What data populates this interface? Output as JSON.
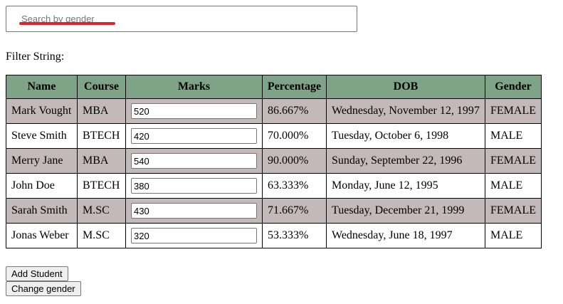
{
  "search": {
    "placeholder": "Search by gender",
    "value": ""
  },
  "filter": {
    "label": "Filter String:"
  },
  "table": {
    "headers": [
      "Name",
      "Course",
      "Marks",
      "Percentage",
      "DOB",
      "Gender"
    ],
    "rows": [
      {
        "name": "Mark Vought",
        "course": "MBA",
        "marks": "520",
        "percentage": "86.667%",
        "dob": "Wednesday, November 12, 1997",
        "gender": "FEMALE"
      },
      {
        "name": "Steve Smith",
        "course": "BTECH",
        "marks": "420",
        "percentage": "70.000%",
        "dob": "Tuesday, October 6, 1998",
        "gender": "MALE"
      },
      {
        "name": "Merry Jane",
        "course": "MBA",
        "marks": "540",
        "percentage": "90.000%",
        "dob": "Sunday, September 22, 1996",
        "gender": "FEMALE"
      },
      {
        "name": "John Doe",
        "course": "BTECH",
        "marks": "380",
        "percentage": "63.333%",
        "dob": "Monday, June 12, 1995",
        "gender": "MALE"
      },
      {
        "name": "Sarah Smith",
        "course": "M.SC",
        "marks": "430",
        "percentage": "71.667%",
        "dob": "Tuesday, December 21, 1999",
        "gender": "FEMALE"
      },
      {
        "name": "Jonas Weber",
        "course": "M.SC",
        "marks": "320",
        "percentage": "53.333%",
        "dob": "Wednesday, June 18, 1997",
        "gender": "MALE"
      }
    ]
  },
  "buttons": {
    "add_student": "Add Student",
    "change_gender": "Change gender"
  },
  "colors": {
    "header_bg": "#7ea386",
    "female_row_bg": "#c4b9b9",
    "annotation_underline": "#e8202a"
  }
}
